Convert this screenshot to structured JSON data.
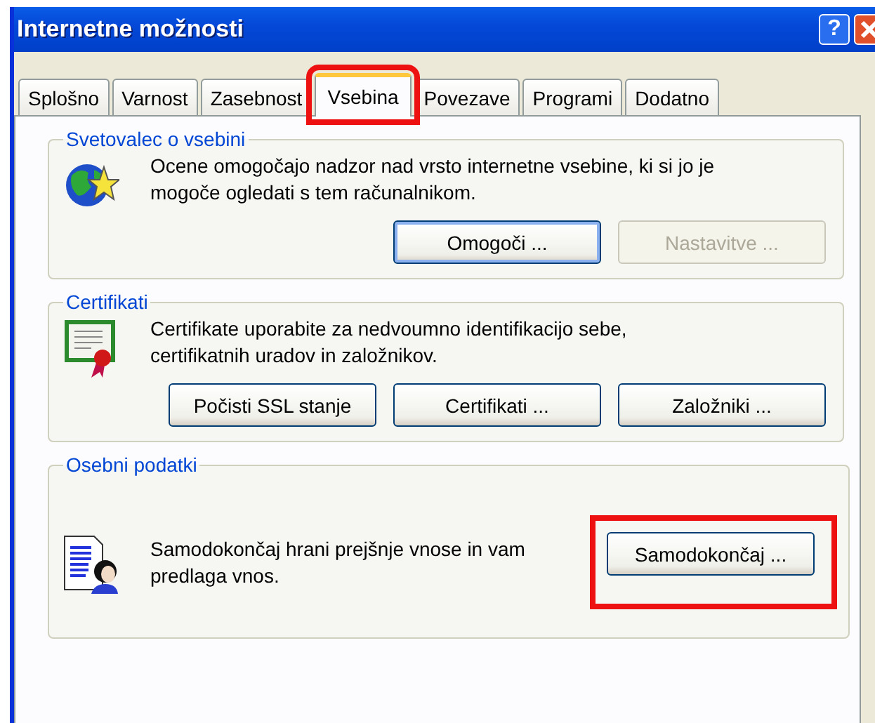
{
  "window": {
    "title": "Internetne možnosti",
    "title_buttons": [
      {
        "kind": "help",
        "label": "?"
      },
      {
        "kind": "close"
      }
    ]
  },
  "tabs": [
    {
      "label": "Splošno",
      "selected": false,
      "highlighted": false
    },
    {
      "label": "Varnost",
      "selected": false,
      "highlighted": false
    },
    {
      "label": "Zasebnost",
      "selected": false,
      "highlighted": false
    },
    {
      "label": "Vsebina",
      "selected": true,
      "highlighted": true
    },
    {
      "label": "Povezave",
      "selected": false,
      "highlighted": false
    },
    {
      "label": "Programi",
      "selected": false,
      "highlighted": false
    },
    {
      "label": "Dodatno",
      "selected": false,
      "highlighted": false
    }
  ],
  "groups": [
    {
      "title": "Svetovalec o vsebini",
      "kind": "rating",
      "text": "Ocene omogočajo nadzor nad vrsto internetne vsebine, ki si jo je mogoče ogledati s tem računalnikom.",
      "buttons": [
        {
          "label": "Omogoči ...",
          "disabled": false,
          "default": true,
          "highlighted": false
        },
        {
          "label": "Nastavitve ...",
          "disabled": true,
          "default": false,
          "highlighted": false
        }
      ]
    },
    {
      "title": "Certifikati",
      "kind": "certificates",
      "text": "Certifikate uporabite za nedvoumno identifikacijo sebe, certifikatnih uradov in založnikov.",
      "buttons": [
        {
          "label": "Počisti SSL stanje",
          "disabled": false,
          "default": false,
          "highlighted": false
        },
        {
          "label": "Certifikati ...",
          "disabled": false,
          "default": false,
          "highlighted": false
        },
        {
          "label": "Založniki ...",
          "disabled": false,
          "default": false,
          "highlighted": false
        }
      ]
    },
    {
      "title": "Osebni podatki",
      "kind": "personal",
      "text": "Samodokončaj hrani prejšnje vnose in vam predlaga vnos.",
      "buttons": [
        {
          "label": "Samodokončaj ...",
          "disabled": false,
          "default": false,
          "highlighted": true
        }
      ]
    }
  ]
}
